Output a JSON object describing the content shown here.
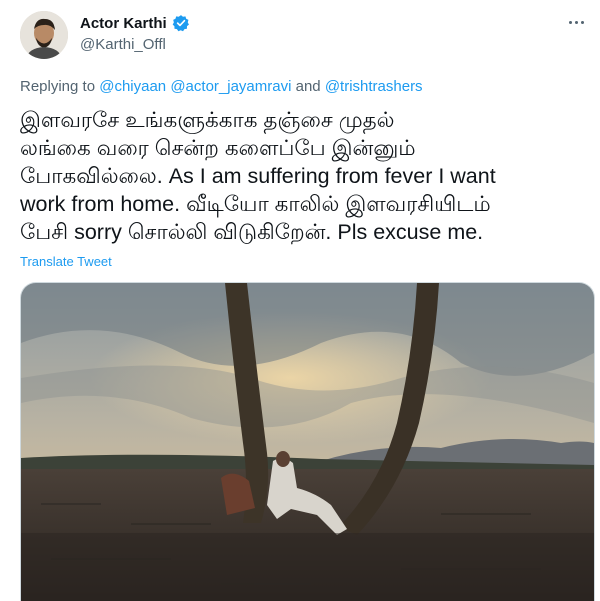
{
  "header": {
    "display_name": "Actor Karthi",
    "handle": "@Karthi_Offl",
    "verified_icon": "verified-badge-icon",
    "more_icon": "more-options-icon"
  },
  "reply": {
    "prefix": "Replying to",
    "mentions": [
      "@chiyaan",
      "@actor_jayamravi",
      "@trishtrashers"
    ],
    "connector": "and"
  },
  "tweet": {
    "lines": [
      "இளவரசே உங்களுக்காக தஞ்சை முதல்",
      "லங்கை வரை சென்ற களைப்பே இன்னும்",
      "போகவில்லை. As I am suffering from fever I want",
      "work from home. வீடியோ காலில் இளவரசியிடம்",
      "பேசி sorry சொல்லி விடுகிறேன். Pls excuse me."
    ],
    "translate_label": "Translate Tweet"
  },
  "colors": {
    "accent": "#1d9bf0",
    "text": "#0f1419",
    "secondary": "#536471"
  }
}
